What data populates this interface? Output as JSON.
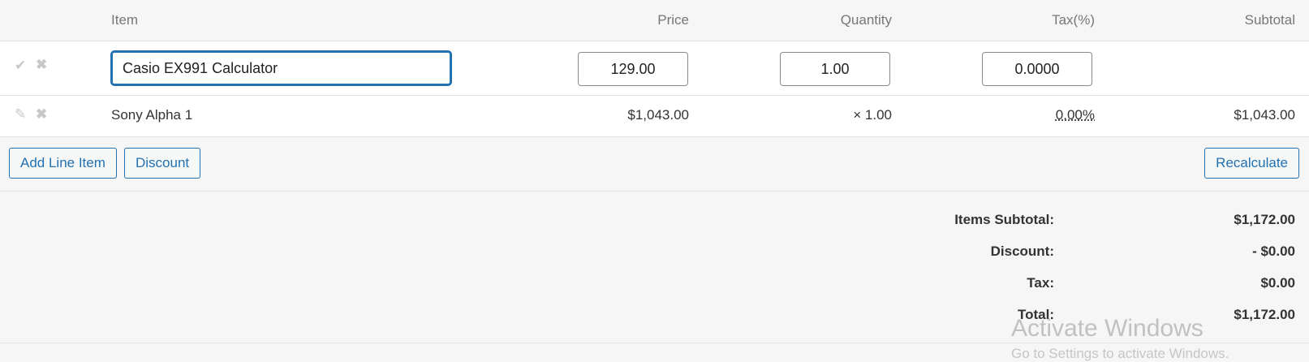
{
  "columns": {
    "item": "Item",
    "price": "Price",
    "quantity": "Quantity",
    "tax": "Tax(%)",
    "subtotal": "Subtotal"
  },
  "edit_row": {
    "save_icon": "checkmark-icon",
    "cancel_icon": "close-icon",
    "item_value": "Casio EX991 Calculator",
    "price_value": "129.00",
    "quantity_value": "1.00",
    "tax_value": "0.0000"
  },
  "line_items": [
    {
      "edit_icon": "pencil-icon",
      "delete_icon": "close-icon",
      "name": "Sony Alpha 1",
      "price": "$1,043.00",
      "quantity": "× 1.00",
      "tax": "0.00%",
      "subtotal": "$1,043.00"
    }
  ],
  "buttons": {
    "add_line_item": "Add Line Item",
    "discount": "Discount",
    "recalculate": "Recalculate"
  },
  "totals": {
    "items_subtotal_label": "Items Subtotal:",
    "items_subtotal_value": "$1,172.00",
    "discount_label": "Discount:",
    "discount_value": "- $0.00",
    "tax_label": "Tax:",
    "tax_value": "$0.00",
    "total_label": "Total:",
    "total_value": "$1,172.00"
  },
  "watermark": {
    "title": "Activate Windows",
    "subtitle": "Go to Settings to activate Windows."
  },
  "colors": {
    "accent": "#2271b1",
    "background": "#f6f6f6",
    "row_background": "#ffffff",
    "border": "#e2e2e2"
  }
}
